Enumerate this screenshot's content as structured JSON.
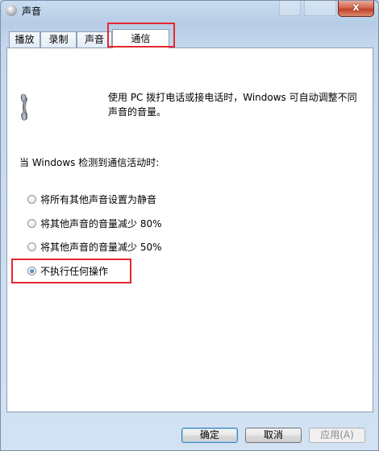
{
  "window": {
    "title": "声音",
    "close_symbol": "x"
  },
  "tabs": [
    {
      "label": "播放"
    },
    {
      "label": "录制"
    },
    {
      "label": "声音"
    },
    {
      "label": "通信",
      "active": true
    }
  ],
  "communications": {
    "description": "使用 PC 拨打电话或接电话时，Windows 可自动调整不同声音的音量。",
    "detect_label": "当 Windows 检测到通信活动时:",
    "options": [
      {
        "label": "将所有其他声音设置为静音",
        "checked": false
      },
      {
        "label": "将其他声音的音量减少 80%",
        "checked": false
      },
      {
        "label": "将其他声音的音量减少 50%",
        "checked": false
      },
      {
        "label": "不执行任何操作",
        "checked": true
      }
    ]
  },
  "buttons": {
    "ok": "确定",
    "cancel": "取消",
    "apply": "应用(A)"
  },
  "icons": {
    "title": "speaker-icon",
    "phone": "telephone-icon",
    "close": "close-icon"
  },
  "colors": {
    "highlight": "#e5282f",
    "selected_radio": "#1b5aa8"
  }
}
